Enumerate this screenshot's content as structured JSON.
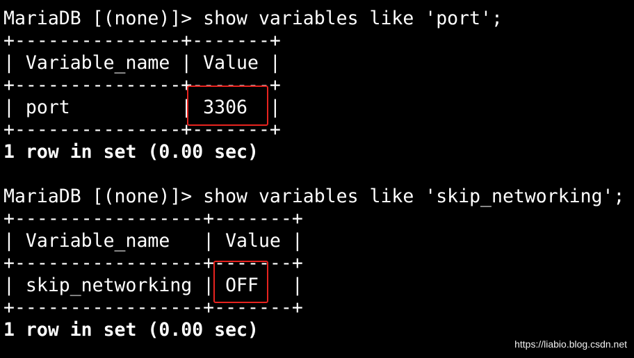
{
  "terminal": {
    "queries": [
      {
        "command": "MariaDB [(none)]> show variables like 'port';",
        "border": "+---------------+-------+",
        "header": "| Variable_name | Value |",
        "row": "| port          | 3306  |",
        "status": "1 row in set (0.00 sec)"
      },
      {
        "command": "MariaDB [(none)]> show variables like 'skip_networking';",
        "border": "+-----------------+-------+",
        "header": "| Variable_name   | Value |",
        "row": "| skip_networking | OFF   |",
        "status": "1 row in set (0.00 sec)"
      }
    ]
  },
  "highlight_color": "#e8231f",
  "watermark": "https://liabio.blog.csdn.net"
}
